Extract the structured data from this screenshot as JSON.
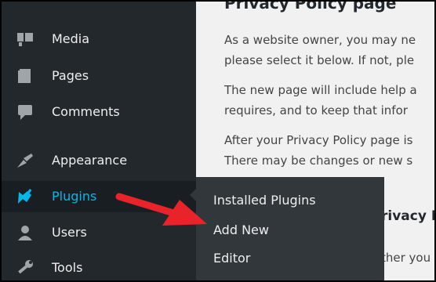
{
  "sidebar": {
    "items": [
      {
        "label": "Media",
        "icon": "media-icon"
      },
      {
        "label": "Pages",
        "icon": "pages-icon"
      },
      {
        "label": "Comments",
        "icon": "comments-icon"
      },
      {
        "label": "Appearance",
        "icon": "appearance-icon"
      },
      {
        "label": "Plugins",
        "icon": "plugins-icon",
        "active": true
      },
      {
        "label": "Users",
        "icon": "users-icon"
      },
      {
        "label": "Tools",
        "icon": "tools-icon"
      }
    ]
  },
  "submenu": {
    "items": [
      "Installed Plugins",
      "Add New",
      "Editor"
    ]
  },
  "content": {
    "heading": "Privacy Policy page",
    "lines": [
      "As a website owner, you may ne",
      "please select it below. If not, ple",
      "The new page will include help a",
      "requires, and to keep that infor",
      "After your Privacy Policy page is",
      "There may be changes or new s",
      "rivacy Po",
      "ther you"
    ]
  },
  "colors": {
    "sidebar_bg": "#23282d",
    "submenu_bg": "#32373c",
    "active_text": "#00b9eb",
    "arrow": "#e8232a",
    "content_bg": "#f1f1f1"
  }
}
